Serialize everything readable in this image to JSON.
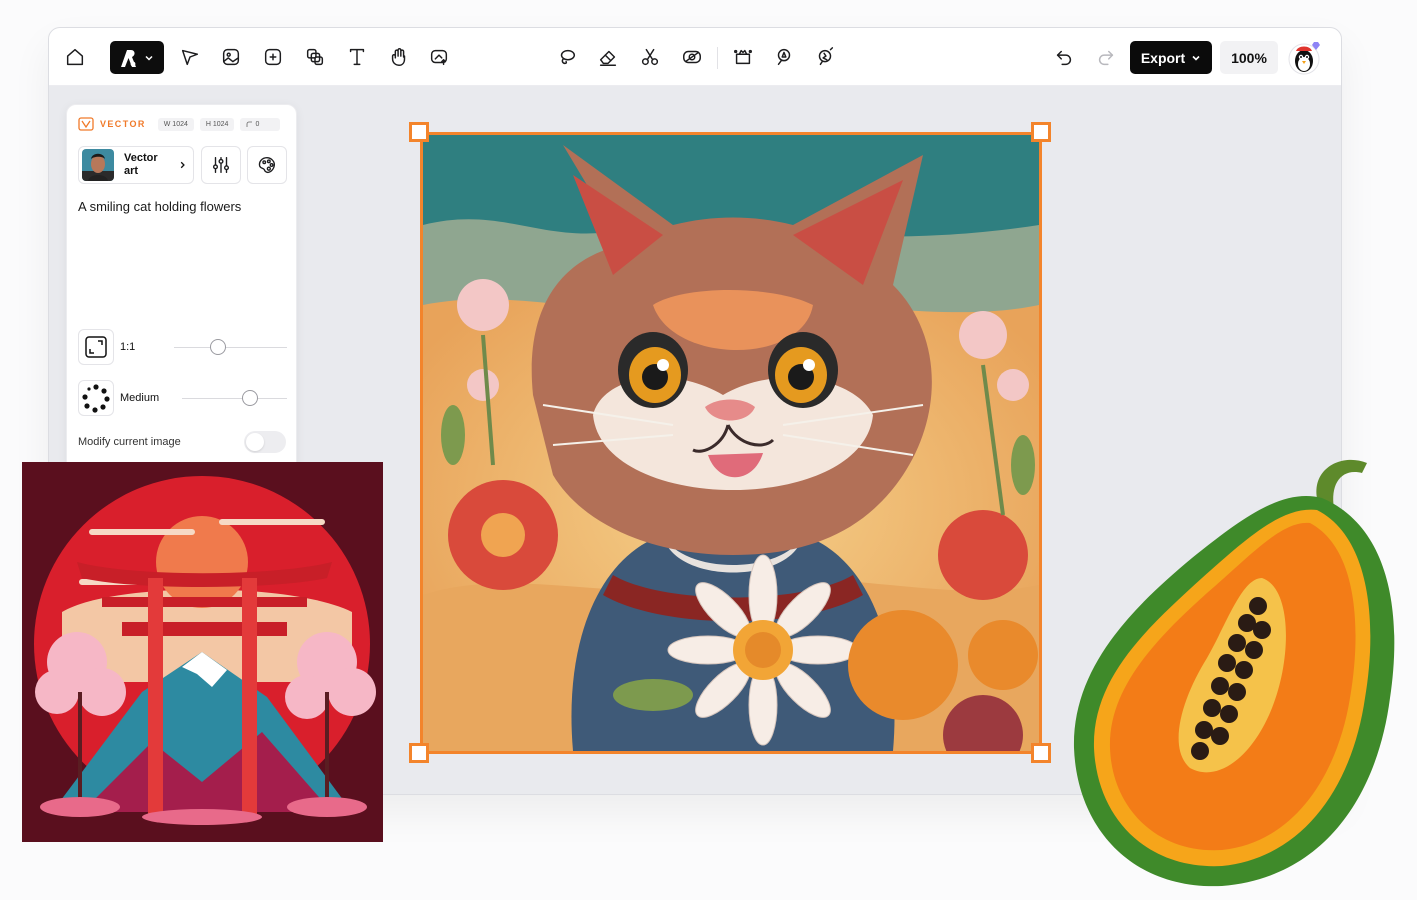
{
  "toolbar": {
    "left_tools": [
      "home-icon",
      "brand-menu",
      "select-arrow-icon",
      "image-icon",
      "image-edit-icon",
      "layers-icon",
      "text-icon",
      "hand-icon",
      "image-upload-icon"
    ],
    "center_tools": [
      "lasso-icon",
      "eraser-icon",
      "scissors-icon",
      "remove-bg-icon",
      "expand-icon",
      "inpaint-icon",
      "brush-magic-icon"
    ],
    "export_label": "Export",
    "zoom_label": "100%"
  },
  "panel": {
    "mode_label": "VECTOR",
    "width_chip": "W 1024",
    "height_chip": "H 1024",
    "corner_chip": "0",
    "style_name": "Vector art",
    "prompt": "A smiling cat holding flowers",
    "ratio_label": "1:1",
    "ratio_value": 0.39,
    "strength_label": "Medium",
    "strength_value": 0.65,
    "modify_label": "Modify current image",
    "modify_enabled": false
  },
  "colors": {
    "accent_orange": "#f3842b",
    "export_bg": "#0b0b0b",
    "torii_red": "#d8212e",
    "papaya_orange": "#f28a16"
  }
}
